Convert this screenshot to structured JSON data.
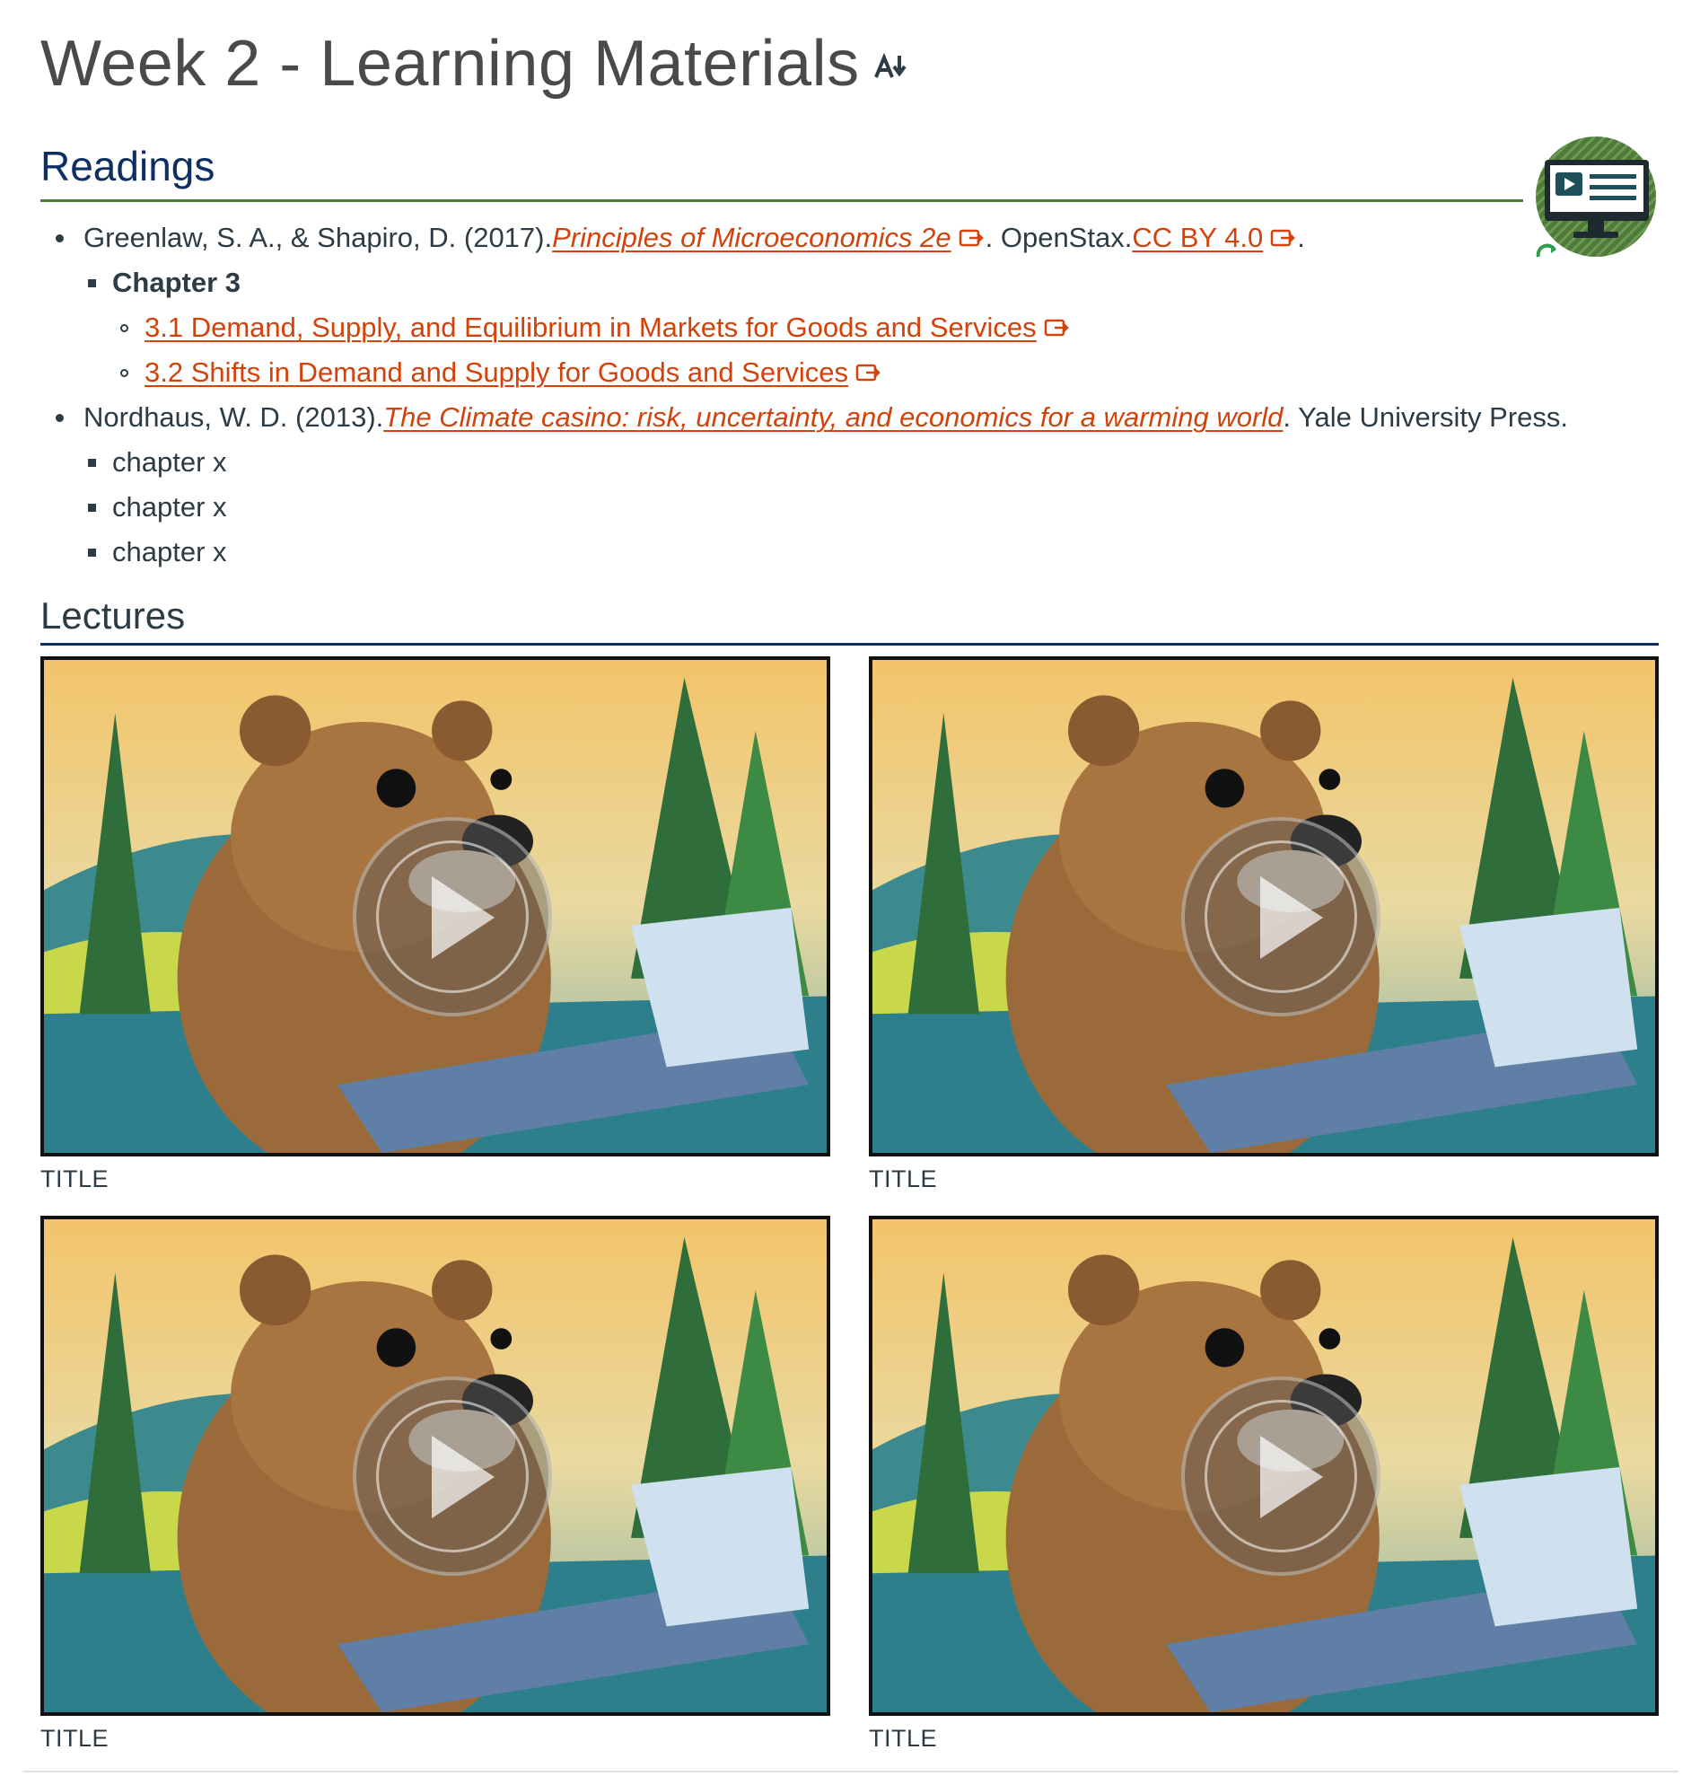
{
  "page": {
    "title": "Week 2 - Learning Materials"
  },
  "readings": {
    "heading": "Readings",
    "items": [
      {
        "prefix": "Greenlaw, S. A., & Shapiro, D. (2017). ",
        "link_text": "Principles of Microeconomics 2e",
        "middle": ". OpenStax. ",
        "license_text": "CC BY 4.0",
        "suffix": ".",
        "subheading": "Chapter 3",
        "sections": [
          "3.1 Demand, Supply, and Equilibrium in Markets for Goods and Services",
          "3.2 Shifts in Demand and Supply for Goods and Services"
        ]
      },
      {
        "prefix": "Nordhaus, W. D. (2013). ",
        "link_text": "The Climate casino: risk, uncertainty, and economics for a warming world",
        "suffix": ". Yale University Press.",
        "chapters": [
          "chapter x",
          "chapter x",
          "chapter x"
        ]
      }
    ]
  },
  "lectures": {
    "heading": "Lectures",
    "videos": [
      {
        "title": "TITLE"
      },
      {
        "title": "TITLE"
      },
      {
        "title": "TITLE"
      },
      {
        "title": "TITLE"
      }
    ]
  },
  "icons": {
    "ai_icon": "ai-text-icon",
    "external_link": "external-link-icon",
    "banner": "video-lecture-monitor-icon",
    "play": "play-icon"
  },
  "colors": {
    "link": "#d4420c",
    "heading": "#0e2f63",
    "readings_rule": "#4f7a3a",
    "banner_green": "#4f7a3a"
  }
}
